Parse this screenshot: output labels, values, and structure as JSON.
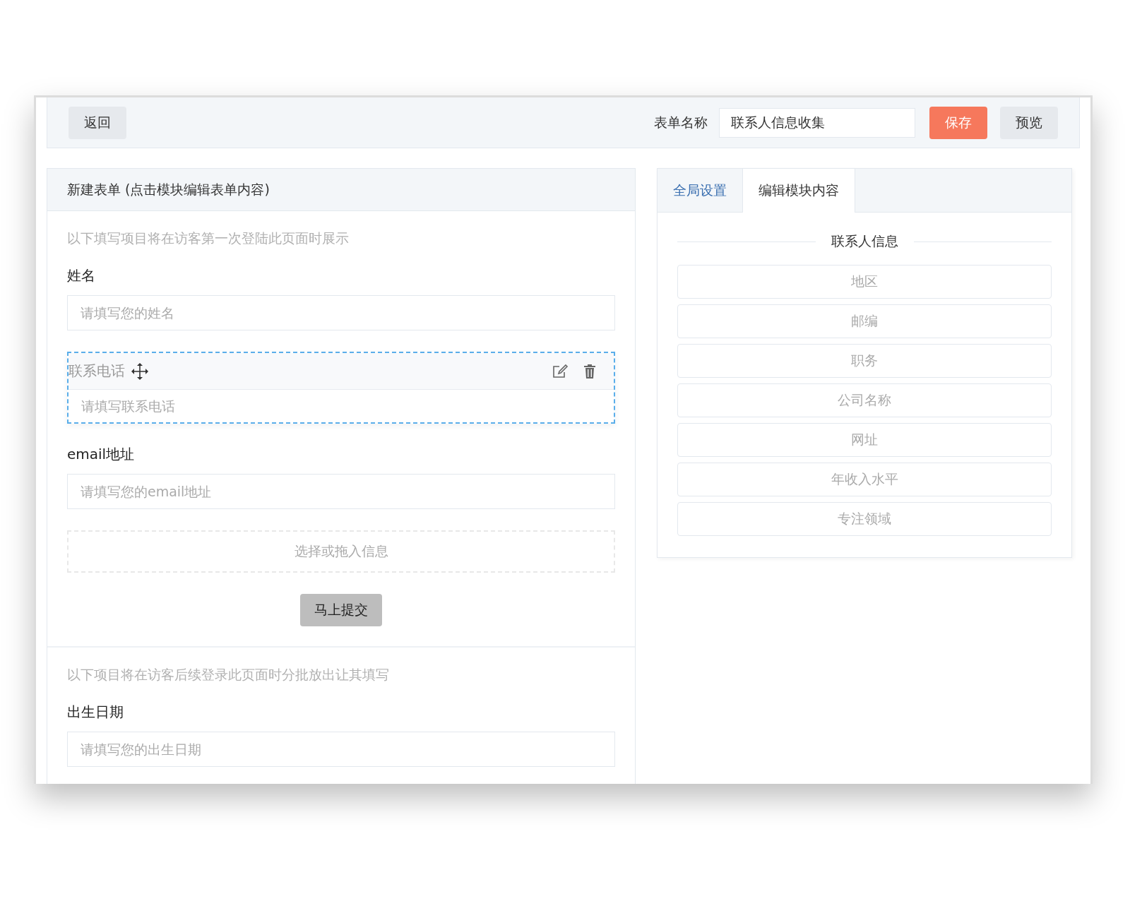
{
  "toolbar": {
    "back": "返回",
    "form_name_label": "表单名称",
    "form_name_value": "联系人信息收集",
    "save": "保存",
    "preview": "预览"
  },
  "form_panel": {
    "title": "新建表单 (点击模块编辑表单内容)",
    "sections": [
      {
        "note": "以下填写项目将在访客第一次登陆此页面时展示",
        "fields": [
          {
            "label": "姓名",
            "placeholder": "请填写您的姓名",
            "selected": false
          },
          {
            "label": "联系电话",
            "placeholder": "请填写联系电话",
            "selected": true
          },
          {
            "label": "email地址",
            "placeholder": "请填写您的email地址",
            "selected": false
          }
        ],
        "drop_zone": "选择或拖入信息",
        "submit": "马上提交"
      },
      {
        "note": "以下项目将在访客后续登录此页面时分批放出让其填写",
        "fields": [
          {
            "label": "出生日期",
            "placeholder": "请填写您的出生日期",
            "selected": false
          }
        ]
      }
    ]
  },
  "settings_panel": {
    "tabs": [
      {
        "label": "全局设置",
        "selected": false
      },
      {
        "label": "编辑模块内容",
        "selected": true
      }
    ],
    "group_title": "联系人信息",
    "items": [
      "地区",
      "邮编",
      "职务",
      "公司名称",
      "网址",
      "年收入水平",
      "专注领域"
    ]
  }
}
